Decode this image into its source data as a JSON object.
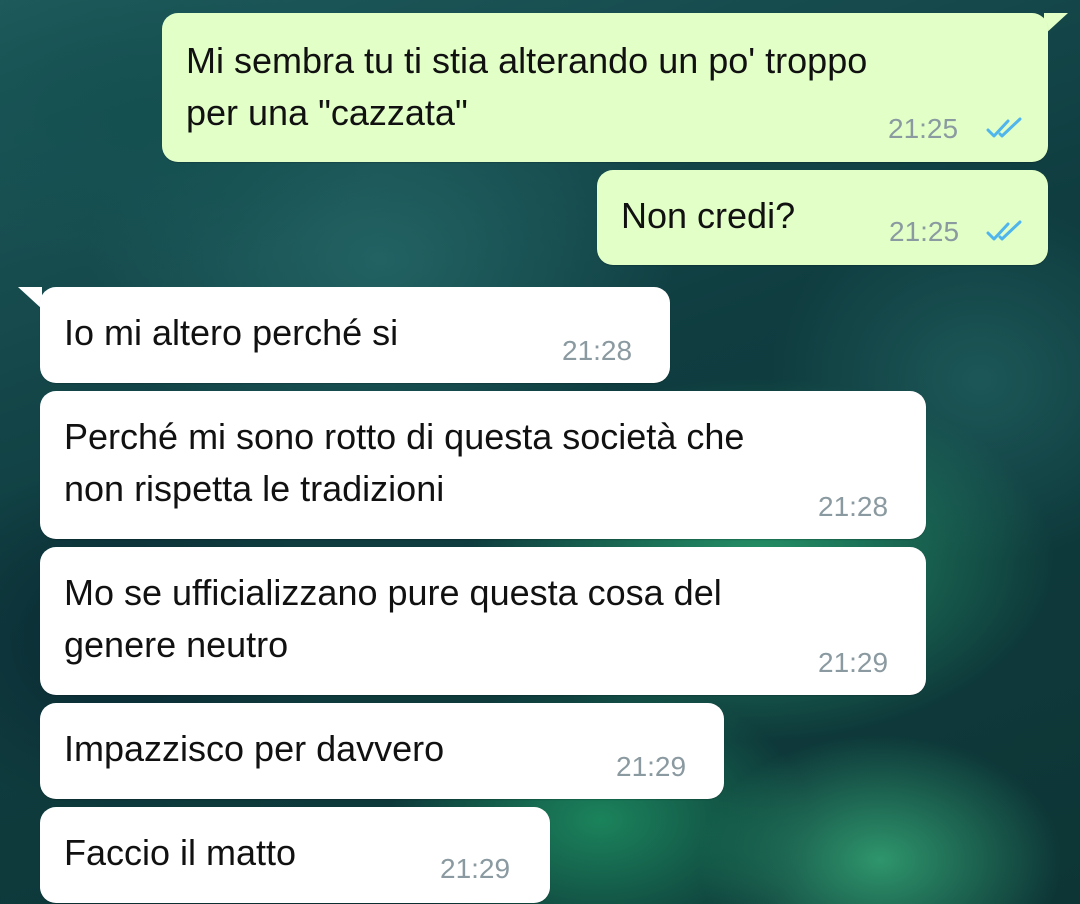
{
  "messages": [
    {
      "direction": "outgoing",
      "lines": [
        "Mi sembra tu ti stia alterando un po' troppo",
        "per una \"cazzata\""
      ],
      "time": "21:25",
      "status": "read"
    },
    {
      "direction": "outgoing",
      "lines": [
        "Non credi?"
      ],
      "time": "21:25",
      "status": "read"
    },
    {
      "direction": "incoming",
      "lines": [
        "Io mi altero perché si"
      ],
      "time": "21:28"
    },
    {
      "direction": "incoming",
      "lines": [
        "Perché mi sono rotto di questa società che",
        "non rispetta le tradizioni"
      ],
      "time": "21:28"
    },
    {
      "direction": "incoming",
      "lines": [
        "Mo se ufficializzano pure questa cosa del",
        "genere neutro"
      ],
      "time": "21:29"
    },
    {
      "direction": "incoming",
      "lines": [
        "Impazzisco per davvero"
      ],
      "time": "21:29"
    },
    {
      "direction": "incoming",
      "lines": [
        "Faccio il matto"
      ],
      "time": "21:29"
    }
  ],
  "colors": {
    "outgoing_bubble": "#e2ffc7",
    "incoming_bubble": "#ffffff",
    "read_ticks": "#4fb5ec",
    "timestamp": "#8a9aa0"
  },
  "icons": {
    "read_status": "double-check-icon"
  }
}
